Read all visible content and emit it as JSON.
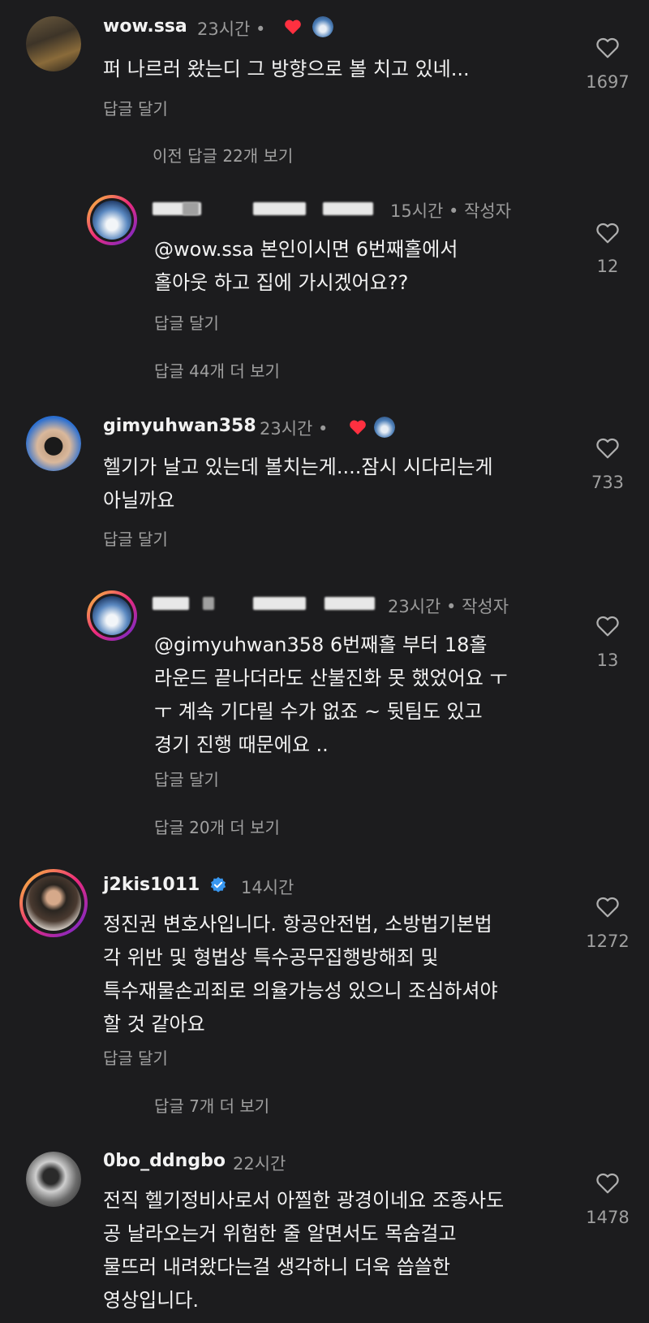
{
  "comments": [
    {
      "username": "wow.ssa",
      "time": "23시간 •",
      "text_lines": [
        "퍼 나르러 왔는디 그 방향으로 볼 치고 있네..."
      ],
      "reply_label": "답글 달기",
      "likes": "1697",
      "more_replies": "이전 답글 22개 보기"
    },
    {
      "time": "15시간 • 작성자",
      "text_lines": [
        "@wow.ssa 본인이시면 6번째홀에서",
        "홀아웃 하고 집에 가시겠어요??"
      ],
      "reply_label": "답글 달기",
      "likes": "12",
      "more_replies": "답글 44개 더 보기"
    },
    {
      "username": "gimyuhwan358",
      "time": "23시간 •",
      "text_lines": [
        "헬기가 날고 있는데 볼치는게....잠시 시다리는게",
        "아닐까요"
      ],
      "reply_label": "답글 달기",
      "likes": "733"
    },
    {
      "time": "23시간 • 작성자",
      "text_lines": [
        "@gimyuhwan358 6번째홀 부터 18홀",
        "라운드 끝나더라도 산불진화 못 했었어요 ㅜ",
        "ㅜ 계속 기다릴 수가 없죠 ~ 뒷팀도 있고",
        "경기 진행 때문에요 .."
      ],
      "reply_label": "답글 달기",
      "likes": "13",
      "more_replies": "답글 20개 더 보기"
    },
    {
      "username": "j2kis1011",
      "time": "14시간",
      "text_lines": [
        "정진권 변호사입니다. 항공안전법, 소방법기본법",
        "각 위반 및 형법상 특수공무집행방해죄 및",
        "특수재물손괴죄로 의율가능성 있으니 조심하셔야",
        "할 것 같아요"
      ],
      "reply_label": "답글 달기",
      "likes": "1272",
      "more_replies": "답글 7개 더 보기"
    },
    {
      "username": "0bo_ddngbo",
      "time": "22시간",
      "text_lines": [
        "전직 헬기정비사로서 아찔한 광경이네요 조종사도",
        "공 날라오는거 위험한 줄 알면서도 목숨걸고",
        "물뜨러 내려왔다는걸 생각하니 더욱 씁쓸한",
        "영상입니다."
      ],
      "likes": "1478"
    }
  ],
  "icons": {
    "like": "heart-outline-icon",
    "creator_liked": "red-heart-icon",
    "verified": "verified-badge-icon"
  },
  "colors": {
    "background": "#1c1c1e",
    "text": "#f2f2f2",
    "secondary": "#9a9a9a",
    "verified": "#3897f0",
    "liked": "#ff3040"
  }
}
